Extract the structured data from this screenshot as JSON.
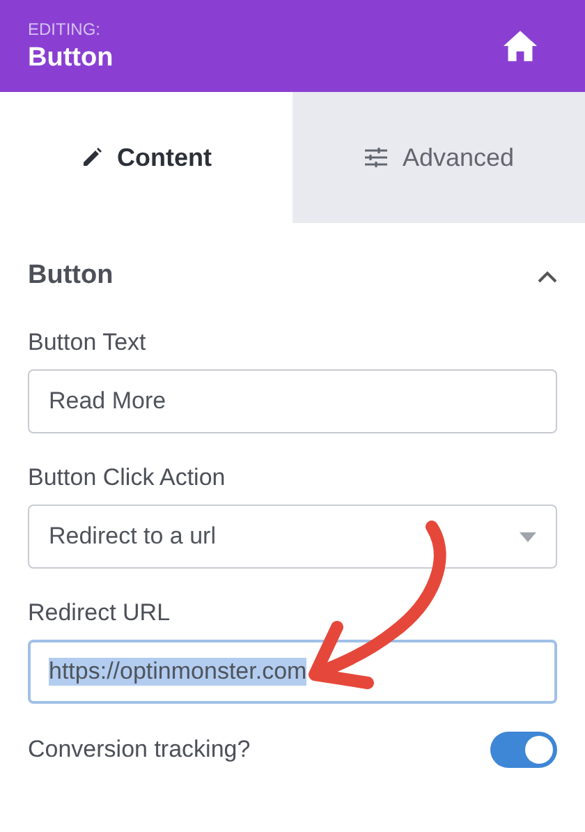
{
  "header": {
    "eyebrow": "EDITING:",
    "title": "Button"
  },
  "tabs": [
    {
      "label": "Content",
      "selected": true
    },
    {
      "label": "Advanced",
      "selected": false
    }
  ],
  "section": {
    "title": "Button",
    "expanded": true
  },
  "fields": [
    {
      "kind": "text",
      "label": "Button Text",
      "value": "Read More",
      "focused": false
    },
    {
      "kind": "select",
      "label": "Button Click Action",
      "value": "Redirect to a url",
      "focused": false
    },
    {
      "kind": "text",
      "label": "Redirect URL",
      "value": "https://optinmonster.com",
      "focused": true,
      "highlighted": true
    },
    {
      "kind": "toggle",
      "label": "Conversion tracking?",
      "on": true
    }
  ]
}
